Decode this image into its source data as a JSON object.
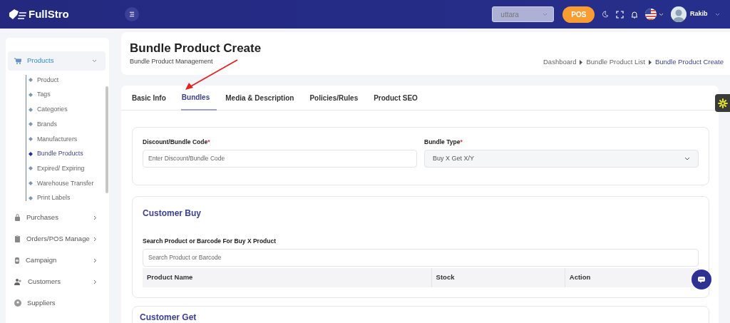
{
  "header": {
    "logo_text": "FullStro",
    "store_select": {
      "value": "uttara"
    },
    "pos_button": "POS",
    "user": {
      "name": "Rakib"
    }
  },
  "sidebar": {
    "items": [
      {
        "label": "Products",
        "has_submenu": true,
        "expanded": true,
        "selected": true,
        "children": [
          {
            "label": "Product",
            "selected": false
          },
          {
            "label": "Tags",
            "selected": false
          },
          {
            "label": "Categories",
            "selected": false
          },
          {
            "label": "Brands",
            "selected": false
          },
          {
            "label": "Manufacturers",
            "selected": false
          },
          {
            "label": "Bundle Products",
            "selected": true
          },
          {
            "label": "Expired/ Expiring",
            "selected": false
          },
          {
            "label": "Warehouse Transfer",
            "selected": false
          },
          {
            "label": "Print Labels",
            "selected": false
          }
        ]
      },
      {
        "label": "Purchases",
        "has_submenu": true,
        "expanded": false,
        "selected": false
      },
      {
        "label": "Orders/POS Manage",
        "has_submenu": true,
        "expanded": false,
        "selected": false
      },
      {
        "label": "Campaign",
        "has_submenu": true,
        "expanded": false,
        "selected": false
      },
      {
        "label": "Customers",
        "has_submenu": true,
        "expanded": false,
        "selected": false
      },
      {
        "label": "Suppliers",
        "has_submenu": false,
        "expanded": false,
        "selected": false
      }
    ]
  },
  "page": {
    "title": "Bundle Product Create",
    "subtitle": "Bundle Product Management",
    "breadcrumb": [
      {
        "label": "Dashboard",
        "selected": false
      },
      {
        "label": "Bundle Product List",
        "selected": false
      },
      {
        "label": "Bundle Product Create",
        "selected": true
      }
    ]
  },
  "tabs": [
    {
      "label": "Basic Info",
      "selected": false
    },
    {
      "label": "Bundles",
      "selected": true
    },
    {
      "label": "Media & Description",
      "selected": false
    },
    {
      "label": "Policies/Rules",
      "selected": false
    },
    {
      "label": "Product SEO",
      "selected": false
    }
  ],
  "form": {
    "fields": [
      {
        "kind": "input",
        "label": "Discount/Bundle Code",
        "required_mark": "*",
        "placeholder": "Enter Discount/Bundle Code"
      },
      {
        "kind": "select",
        "label": "Bundle Type",
        "required_mark": "*",
        "value": "Buy X Get X/Y"
      }
    ]
  },
  "customer_buy": {
    "title": "Customer Buy",
    "search_label": "Search Product or Barcode For Buy X Product",
    "search_placeholder": "Search Product or Barcode",
    "columns": [
      "Product Name",
      "Stock",
      "Action"
    ]
  },
  "customer_get": {
    "title": "Customer Get"
  }
}
